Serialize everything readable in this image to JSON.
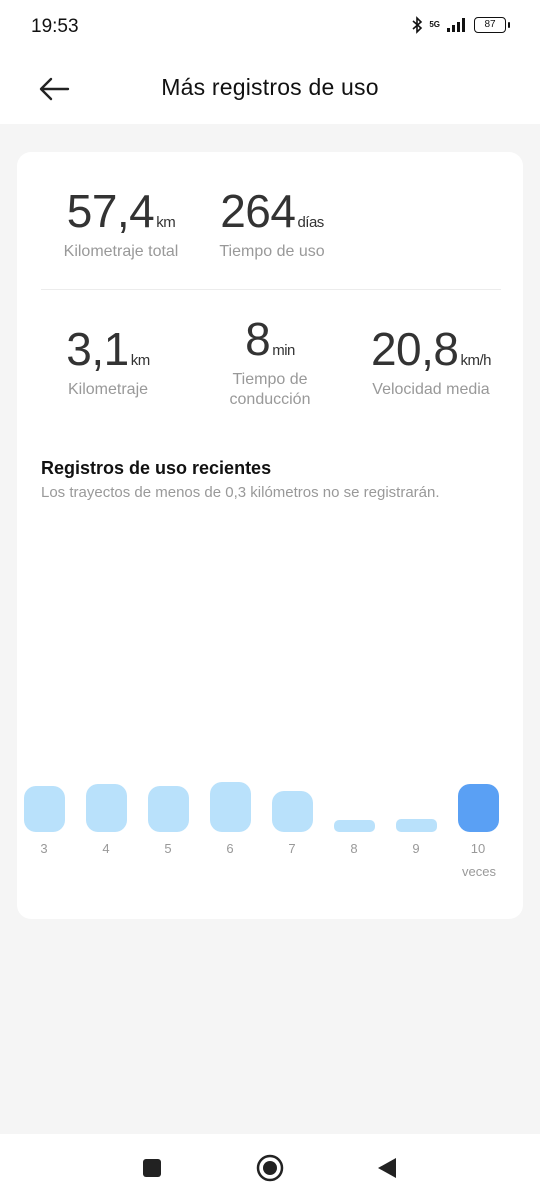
{
  "status_bar": {
    "time": "19:53",
    "network": "5G",
    "battery": "87",
    "icons": [
      "bluetooth-icon",
      "signal-icon",
      "battery-icon"
    ]
  },
  "header": {
    "title": "Más registros de uso",
    "back_icon": "arrow-left-icon"
  },
  "summary": {
    "total_distance": {
      "value": "57,4",
      "unit": "km",
      "label": "Kilometraje total"
    },
    "usage_time": {
      "value": "264",
      "unit": "días",
      "label": "Tiempo de uso"
    }
  },
  "trip": {
    "distance": {
      "value": "3,1",
      "unit": "km",
      "label": "Kilometraje"
    },
    "drive_time": {
      "value": "8",
      "unit": "min",
      "label_line1": "Tiempo de",
      "label_line2": "conducción"
    },
    "avg_speed": {
      "value": "20,8",
      "unit": "km/h",
      "label": "Velocidad media"
    }
  },
  "recent": {
    "title": "Registros de uso recientes",
    "subtitle": "Los trayectos de menos de 0,3 kilómetros no se registrarán.",
    "x_unit": "veces"
  },
  "chart_data": {
    "type": "bar",
    "categories": [
      "3",
      "4",
      "5",
      "6",
      "7",
      "8",
      "9",
      "10"
    ],
    "values": [
      0.95,
      1.0,
      0.95,
      1.05,
      0.85,
      0.25,
      0.28,
      1.0
    ],
    "highlighted": "10",
    "colors": {
      "bar": "#b9e1fb",
      "active": "#5aa0f4"
    },
    "xlabel": "veces"
  },
  "nav": {
    "icons": [
      "square-icon",
      "home-circle-icon",
      "back-triangle-icon"
    ]
  }
}
